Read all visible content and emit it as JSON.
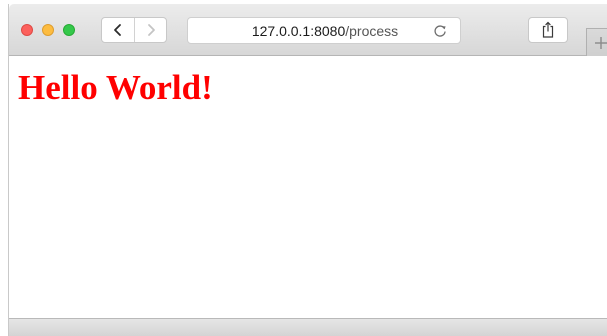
{
  "browser": {
    "address_bar": {
      "url_host": "127.0.0.1:8080",
      "url_path": "/process"
    },
    "icons": {
      "back": "chevron-left-icon",
      "forward": "chevron-right-icon",
      "reload": "reload-icon",
      "share": "share-icon",
      "new_tab": "plus-icon"
    }
  },
  "page": {
    "heading": "Hello World!"
  },
  "colors": {
    "heading": "#ff0000",
    "close": "#fc605c",
    "minimize": "#fdbc40",
    "zoom": "#34c84a"
  }
}
